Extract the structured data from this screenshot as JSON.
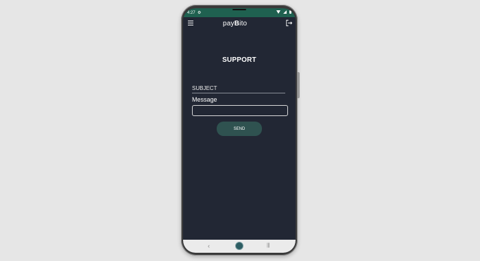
{
  "status_bar": {
    "time": "4:27",
    "icons": [
      "gear-icon",
      "wifi-icon",
      "signal-icon",
      "battery-icon"
    ]
  },
  "header": {
    "logo_prefix": "pay",
    "logo_b": "B",
    "logo_suffix": "ito",
    "icons": [
      "menu-icon",
      "logout-icon"
    ]
  },
  "page": {
    "title": "SUPPORT",
    "subject_placeholder": "SUBJECT",
    "message_label": "Message",
    "send_label": "SEND"
  },
  "nav_bar": {
    "back_glyph": "‹",
    "recents_glyph": "|||"
  },
  "colors": {
    "background": "#222734",
    "status_bar": "#1f6150",
    "send_button": "#2f5250"
  }
}
